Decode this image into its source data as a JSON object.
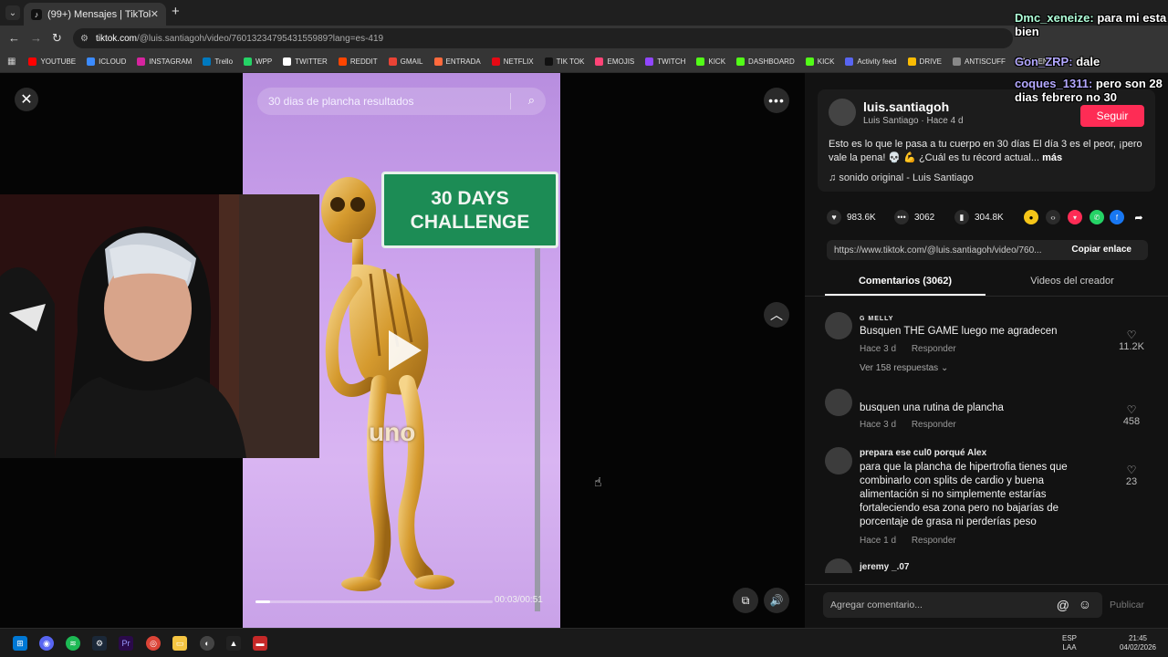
{
  "browser": {
    "tab_title": "(99+) Mensajes | TikTok",
    "new_tab_symbol": "+",
    "close_tab_symbol": "✕",
    "url_host": "tiktok.com",
    "url_path": "/@luis.santiagoh/video/7601323479543155989?lang=es-419"
  },
  "bookmarks": [
    {
      "label": "YOUTUBE",
      "color": "#ff0000"
    },
    {
      "label": "ICLOUD",
      "color": "#3b8bff"
    },
    {
      "label": "INSTAGRAM",
      "color": "#d6249f"
    },
    {
      "label": "Trello",
      "color": "#0079bf"
    },
    {
      "label": "WPP",
      "color": "#25d366"
    },
    {
      "label": "TWITTER",
      "color": "#ffffff"
    },
    {
      "label": "REDDIT",
      "color": "#ff4500"
    },
    {
      "label": "GMAIL",
      "color": "#ea4335"
    },
    {
      "label": "ENTRADA",
      "color": "#ff6a3d"
    },
    {
      "label": "NETFLIX",
      "color": "#e50914"
    },
    {
      "label": "TIK TOK",
      "color": "#111111"
    },
    {
      "label": "EMOJIS",
      "color": "#ff4477"
    },
    {
      "label": "TWITCH",
      "color": "#9146ff"
    },
    {
      "label": "KICK",
      "color": "#53fc18"
    },
    {
      "label": "DASHBOARD",
      "color": "#53fc18"
    },
    {
      "label": "KICK",
      "color": "#53fc18"
    },
    {
      "label": "Activity feed",
      "color": "#5865f2"
    },
    {
      "label": "DRIVE",
      "color": "#fbbc04"
    },
    {
      "label": "ANTISCUFF",
      "color": "#888888"
    },
    {
      "label": "FUEN",
      "color": "#cccccc"
    }
  ],
  "video": {
    "search_placeholder": "30 dias de plancha resultados",
    "sign_line1": "30 DAYS",
    "sign_line2": "CHALLENGE",
    "caption": "uno",
    "time": "00:03/00:51",
    "progress": 0.06
  },
  "post": {
    "username": "luis.santiagoh",
    "subline": "Luis Santiago · Hace 4 d",
    "follow_label": "Seguir",
    "description": "Esto es lo que le pasa a tu cuerpo en 30 días El día 3 es el peor, ¡pero vale la pena! 💀 💪 ¿Cuál es tu récord actual...",
    "more_label": "más",
    "sound": "sonido original - Luis Santiago",
    "likes": "983.6K",
    "comments": "3062",
    "saves": "304.8K",
    "link": "https://www.tiktok.com/@luis.santiagoh/video/760...",
    "copy_label": "Copiar enlace"
  },
  "tabs": {
    "comments": "Comentarios (3062)",
    "creator_videos": "Videos del creador"
  },
  "comments": [
    {
      "user": "G MELLY",
      "text": "Busquen THE GAME luego me agradecen",
      "time": "Hace 3 d",
      "reply": "Responder",
      "likes": "11.2K",
      "replies": "Ver 158 respuestas"
    },
    {
      "user": "",
      "text": "busquen una rutina de plancha",
      "time": "Hace 3 d",
      "reply": "Responder",
      "likes": "458"
    },
    {
      "user": "prepara ese cul0 porqué Alex",
      "text": "para que la plancha de hipertrofia tienes que combinarlo con splits de cardio y buena alimentación si no simplemente estarías fortaleciendo esa zona pero no bajarías de porcentaje de grasa ni perderías peso",
      "time": "Hace 1 d",
      "reply": "Responder",
      "likes": "23"
    },
    {
      "user": "jeremy _.07"
    }
  ],
  "comment_bar": {
    "placeholder": "Agregar comentario...",
    "publish": "Publicar"
  },
  "chat": [
    {
      "user": "Dmc_xeneize:",
      "msg": "para mi esta bien"
    },
    {
      "user": "Gon_ZRP:",
      "msg": "dale"
    },
    {
      "user": "coques_1311:",
      "msg": "pero son 28 dias febrero no 30"
    }
  ],
  "taskbar": {
    "lang_top": "ESP",
    "lang_bottom": "LAA",
    "time": "21:45",
    "date": "04/02/2026"
  }
}
